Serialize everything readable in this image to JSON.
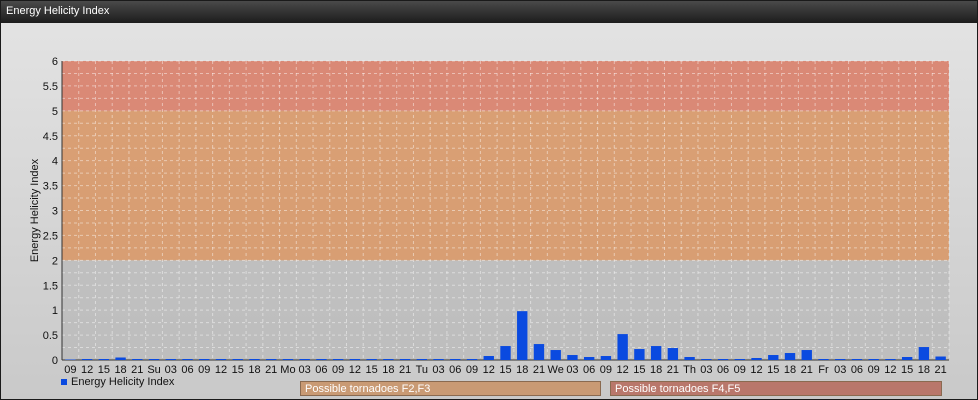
{
  "window": {
    "title": "Energy Helicity Index"
  },
  "colors": {
    "bar": "#0a4ae0",
    "zone_low": "#bcbcbc",
    "zone_mid": "#d89868",
    "zone_high": "#d9806a"
  },
  "chart_data": {
    "type": "bar",
    "title": "",
    "ylabel": "Energy Helicity Index",
    "xlabel": "",
    "ylim": [
      0,
      6
    ],
    "yticks": [
      "0",
      "0.5",
      "1",
      "1.5",
      "2",
      "2.5",
      "3",
      "3.5",
      "4",
      "4.5",
      "5",
      "5.5",
      "6"
    ],
    "categories": [
      "09",
      "12",
      "15",
      "18",
      "21",
      "Su",
      "03",
      "06",
      "09",
      "12",
      "15",
      "18",
      "21",
      "Mo",
      "03",
      "06",
      "09",
      "12",
      "15",
      "18",
      "21",
      "Tu",
      "03",
      "06",
      "09",
      "12",
      "15",
      "18",
      "21",
      "We",
      "03",
      "06",
      "09",
      "12",
      "15",
      "18",
      "21",
      "Th",
      "03",
      "06",
      "09",
      "12",
      "15",
      "18",
      "21",
      "Fr",
      "03",
      "06",
      "09",
      "12",
      "15",
      "18",
      "21"
    ],
    "series": [
      {
        "name": "Energy Helicity Index",
        "values": [
          0.01,
          0.02,
          0.02,
          0.05,
          0.02,
          0.02,
          0.02,
          0.02,
          0.02,
          0.02,
          0.02,
          0.02,
          0.02,
          0.02,
          0.02,
          0.02,
          0.02,
          0.02,
          0.02,
          0.02,
          0.02,
          0.02,
          0.02,
          0.02,
          0.02,
          0.08,
          0.28,
          0.98,
          0.32,
          0.2,
          0.1,
          0.06,
          0.08,
          0.52,
          0.22,
          0.28,
          0.24,
          0.06,
          0.02,
          0.02,
          0.02,
          0.04,
          0.1,
          0.14,
          0.2,
          0.02,
          0.02,
          0.02,
          0.02,
          0.02,
          0.06,
          0.26,
          0.07
        ]
      }
    ],
    "zones": [
      {
        "from": 0,
        "to": 2
      },
      {
        "from": 2,
        "to": 5
      },
      {
        "from": 5,
        "to": 6
      }
    ],
    "legend_position": "bottom-left",
    "grid": true
  },
  "annotations": [
    {
      "label": "Possible tornadoes F2,F3"
    },
    {
      "label": "Possible tornadoes F4,F5"
    }
  ]
}
